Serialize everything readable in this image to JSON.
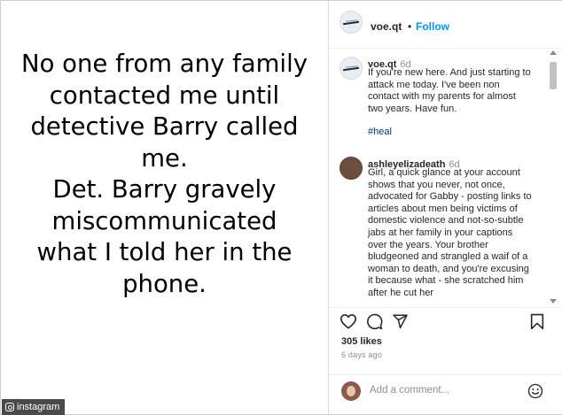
{
  "image_text": {
    "lines": "No one from any family\ncontacted me until\ndetective Barry called\nme.\nDet. Barry gravely\nmiscommunicated\nwhat I told her in the\nphone."
  },
  "watermark": {
    "icon": "instagram-icon",
    "label": "instagram"
  },
  "post": {
    "author": "voe.qt",
    "separator": "•",
    "follow_label": "Follow",
    "comments": [
      {
        "user": "voe.qt",
        "time": "6d",
        "text": "If you're new here. And just starting to attack me today. I've been non contact with my parents for almost two years. Have fun.",
        "hashtag": "#heal"
      },
      {
        "user": "ashleyelizadeath",
        "time": "6d",
        "text": "Girl, a quick glance at your account shows that you never, not once, advocated for Gabby - posting links to articles about men being victims of domestic violence and not-so-subtle jabs at her family in your captions over the years. Your brother bludgeoned and strangled a waif of a woman to death, and you're excusing it because what - she scratched him after he cut her"
      }
    ],
    "likes": "305 likes",
    "posted_ago": "6 days ago",
    "add_comment_placeholder": "Add a comment...",
    "icons": {
      "like": "heart-icon",
      "comment": "comment-icon",
      "share": "share-icon",
      "save": "bookmark-icon",
      "emoji": "emoji-icon"
    }
  },
  "colors": {
    "link_blue": "#0095f6",
    "hashtag": "#00376b",
    "muted": "#8e8e8e"
  }
}
